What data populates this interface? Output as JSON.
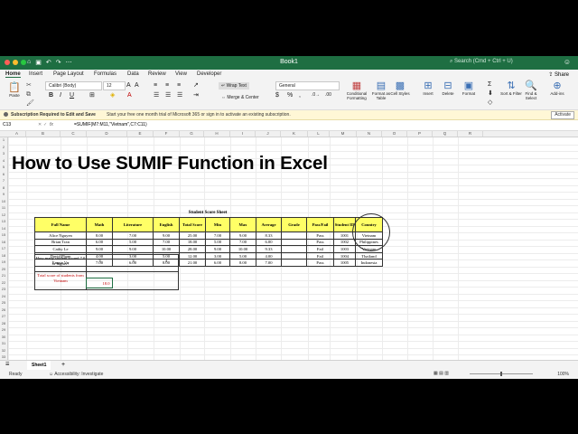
{
  "window": {
    "title": "Book1",
    "search_placeholder": "Search (Cmd + Ctrl + U)",
    "user_icon": "person-icon"
  },
  "ribbon_tabs": [
    "Home",
    "Insert",
    "Page Layout",
    "Formulas",
    "Data",
    "Review",
    "View",
    "Developer"
  ],
  "share_label": "Share",
  "ribbon": {
    "paste": "Paste",
    "font_name": "Calibri (Body)",
    "font_size": "12",
    "wrap_text": "Wrap Text",
    "merge_center": "Merge & Center",
    "number_format": "General",
    "conditional_formatting": "Conditional Formatting",
    "format_as_table": "Format as Table",
    "cell_styles": "Cell Styles",
    "insert": "Insert",
    "delete": "Delete",
    "format": "Format",
    "sort_filter": "Sort & Filter",
    "find_select": "Find & Select",
    "addins": "Add-ins"
  },
  "message_bar": {
    "bold": "Subscription Required to Edit and Save",
    "text": "Start your free one month trial of Microsoft 365 or sign in to activate an existing subscription.",
    "action": "Activate"
  },
  "formula_bar": {
    "cell_ref": "C13",
    "fx": "fx",
    "formula": "=SUMIF(M7:M11,\"Vietnam\",C7:C11)"
  },
  "columns": [
    "A",
    "B",
    "C",
    "D",
    "E",
    "F",
    "G",
    "H",
    "I",
    "J",
    "K",
    "L",
    "M",
    "N",
    "O",
    "P",
    "Q",
    "R"
  ],
  "rows": [
    "1",
    "2",
    "3",
    "4",
    "5",
    "6",
    "7",
    "8",
    "9",
    "10",
    "11",
    "12",
    "13",
    "14",
    "15",
    "16",
    "17",
    "18",
    "19",
    "20",
    "21",
    "22",
    "23",
    "24",
    "25",
    "26",
    "27",
    "28",
    "29",
    "30",
    "31",
    "32",
    "33"
  ],
  "overlay_title": "How to Use SUMIF Function in Excel",
  "sheet_table": {
    "title": "Student Score Sheet",
    "headers": [
      "Full Name",
      "Math",
      "Literature",
      "English",
      "Total Score",
      "Min",
      "Max",
      "Average",
      "Grade",
      "Pass/Fail",
      "Student ID",
      "Country"
    ],
    "rows": [
      [
        "Alice Nguyen",
        "8.00",
        "7.00",
        "9.00",
        "25.00",
        "7.00",
        "9.00",
        "8.33",
        "",
        "Pass",
        "1001",
        "Vietnam"
      ],
      [
        "Brian Tran",
        "6.00",
        "5.00",
        "7.00",
        "18.00",
        "5.00",
        "7.00",
        "6.00",
        "",
        "Pass",
        "1002",
        "Philippines"
      ],
      [
        "Cathy Le",
        "9.00",
        "9.00",
        "10.00",
        "28.00",
        "9.00",
        "10.00",
        "9.33",
        "",
        "Fail",
        "1003",
        "Vietnam"
      ],
      [
        "David Pham",
        "4.00",
        "3.00",
        "5.00",
        "12.00",
        "3.00",
        "5.00",
        "4.00",
        "",
        "Fail",
        "1004",
        "Thailand"
      ],
      [
        "Emma Vu",
        "7.00",
        "6.00",
        "8.00",
        "21.00",
        "6.00",
        "8.00",
        "7.00",
        "",
        "Pass",
        "1005",
        "Indonesia"
      ]
    ],
    "question1": "How many student scored 7.0 or higher?",
    "answers1": [
      "3",
      "3",
      "4"
    ],
    "question2": "Total score of students from Vietnam",
    "answer2": "18.0"
  },
  "sheet_tab": "Sheet1",
  "status": {
    "ready": "Ready",
    "accessibility": "Accessibility: Investigate",
    "zoom": "100%"
  },
  "colors": {
    "excel_green": "#1e6e42",
    "header_yellow": "#ffff66",
    "red_text": "#c00000"
  }
}
